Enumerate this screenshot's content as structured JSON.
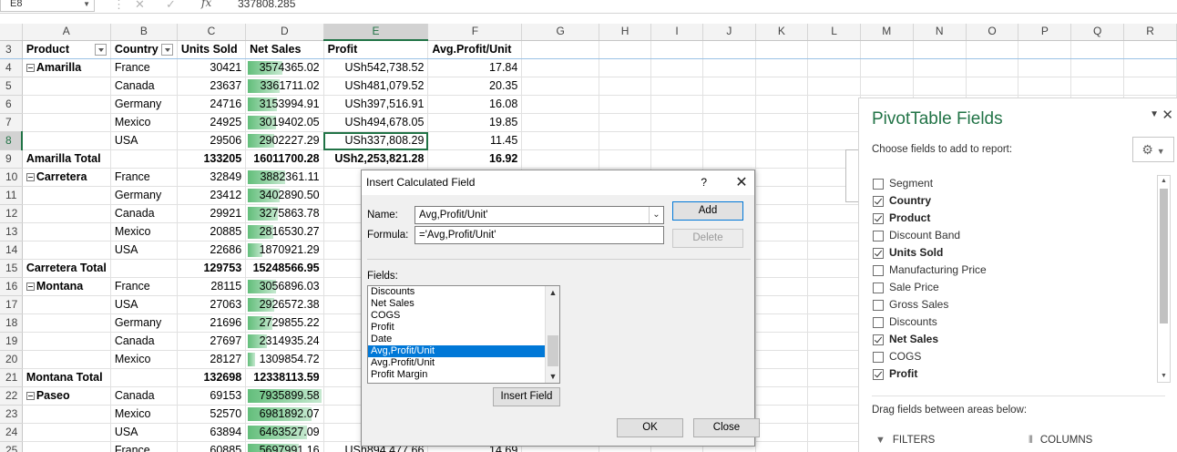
{
  "formula_bar": {
    "name_box": "E8",
    "cancel_icon": "cancel-icon",
    "enter_icon": "enter-icon",
    "fx_label": "fx",
    "content": "337808.285"
  },
  "columns": [
    "A",
    "B",
    "C",
    "D",
    "E",
    "F",
    "G",
    "H",
    "I",
    "J",
    "K",
    "L",
    "M",
    "N",
    "O",
    "P",
    "Q",
    "R"
  ],
  "selected_column": "E",
  "pivot_header": [
    "Product",
    "Country",
    "Units Sold",
    "Net Sales",
    "Profit",
    "Avg.Profit/Unit"
  ],
  "rows": [
    {
      "n": "3",
      "type": "header"
    },
    {
      "n": "4",
      "product": "Amarilla",
      "country": "France",
      "units": "30421",
      "net": "3574365.02",
      "profit": "USh542,738.52",
      "avg": "17.84",
      "collapse": true,
      "bar": 0.49
    },
    {
      "n": "5",
      "product": "",
      "country": "Canada",
      "units": "23637",
      "net": "3361711.02",
      "profit": "USh481,079.52",
      "avg": "20.35",
      "bar": 0.46
    },
    {
      "n": "6",
      "product": "",
      "country": "Germany",
      "units": "24716",
      "net": "3153994.91",
      "profit": "USh397,516.91",
      "avg": "16.08",
      "bar": 0.43
    },
    {
      "n": "7",
      "product": "",
      "country": "Mexico",
      "units": "24925",
      "net": "3019402.05",
      "profit": "USh494,678.05",
      "avg": "19.85",
      "bar": 0.41
    },
    {
      "n": "8",
      "product": "",
      "country": "USA",
      "units": "29506",
      "net": "2902227.29",
      "profit": "USh337,808.29",
      "avg": "11.45",
      "bar": 0.39,
      "active": true
    },
    {
      "n": "9",
      "type": "total",
      "product": "Amarilla Total",
      "units": "133205",
      "net": "16011700.28",
      "profit": "USh2,253,821.28",
      "avg": "16.92"
    },
    {
      "n": "10",
      "product": "Carretera",
      "country": "France",
      "units": "32849",
      "net": "3882361.11",
      "profit": "USh",
      "avg": "",
      "collapse": true,
      "bar": 0.53
    },
    {
      "n": "11",
      "product": "",
      "country": "Germany",
      "units": "23412",
      "net": "3402890.50",
      "profit": "USh",
      "avg": "",
      "bar": 0.46
    },
    {
      "n": "12",
      "product": "",
      "country": "Canada",
      "units": "29921",
      "net": "3275863.78",
      "profit": "USh",
      "avg": "",
      "bar": 0.44
    },
    {
      "n": "13",
      "product": "",
      "country": "Mexico",
      "units": "20885",
      "net": "2816530.27",
      "profit": "USh",
      "avg": "",
      "bar": 0.38
    },
    {
      "n": "14",
      "product": "",
      "country": "USA",
      "units": "22686",
      "net": "1870921.29",
      "profit": "USh",
      "avg": "",
      "bar": 0.23
    },
    {
      "n": "15",
      "type": "total",
      "product": "Carretera Total",
      "units": "129753",
      "net": "15248566.95",
      "profit": "USh2,",
      "avg": ""
    },
    {
      "n": "16",
      "product": "Montana",
      "country": "France",
      "units": "28115",
      "net": "3056896.03",
      "profit": "USh",
      "avg": "",
      "collapse": true,
      "bar": 0.41
    },
    {
      "n": "17",
      "product": "",
      "country": "USA",
      "units": "27063",
      "net": "2926572.38",
      "profit": "USh",
      "avg": "",
      "bar": 0.39
    },
    {
      "n": "18",
      "product": "",
      "country": "Germany",
      "units": "21696",
      "net": "2729855.22",
      "profit": "USh",
      "avg": "",
      "bar": 0.36
    },
    {
      "n": "19",
      "product": "",
      "country": "Canada",
      "units": "27697",
      "net": "2314935.24",
      "profit": "USh",
      "avg": "",
      "bar": 0.3
    },
    {
      "n": "20",
      "product": "",
      "country": "Mexico",
      "units": "28127",
      "net": "1309854.72",
      "profit": "USh",
      "avg": "",
      "bar": 0.14
    },
    {
      "n": "21",
      "type": "total",
      "product": "Montana Total",
      "units": "132698",
      "net": "12338113.59",
      "profit": "USh1,",
      "avg": ""
    },
    {
      "n": "22",
      "product": "Paseo",
      "country": "Canada",
      "units": "69153",
      "net": "7935899.58",
      "profit": "USh1,",
      "avg": "",
      "collapse": true,
      "bar": 1.0
    },
    {
      "n": "23",
      "product": "",
      "country": "Mexico",
      "units": "52570",
      "net": "6981892.07",
      "profit": "USh",
      "avg": "",
      "bar": 0.88
    },
    {
      "n": "24",
      "product": "",
      "country": "USA",
      "units": "63894",
      "net": "6463527.09",
      "profit": "USh",
      "avg": "",
      "bar": 0.81
    },
    {
      "n": "25",
      "product": "",
      "country": "France",
      "units": "60885",
      "net": "5697991.16",
      "profit": "USh894,477.66",
      "avg": "14.69",
      "bar": 0.71
    }
  ],
  "dialog": {
    "title": "Insert Calculated Field",
    "help": "?",
    "close": "✕",
    "name_label": "Name:",
    "name_value": "Avg,Profit/Unit'",
    "formula_label": "Formula:",
    "formula_value": "='Avg,Profit/Unit'",
    "add_label": "Add",
    "delete_label": "Delete",
    "fields_label": "Fields:",
    "fields": [
      "Discounts",
      "Net Sales",
      "COGS",
      "Profit",
      "Date",
      "Avg,Profit/Unit",
      "Avg.Profit/Unit",
      "Profit Margin"
    ],
    "selected_field": 5,
    "insert_field_label": "Insert Field",
    "ok_label": "OK",
    "close_label": "Close"
  },
  "pane": {
    "title": "PivotTable Fields",
    "choose": "Choose fields to add to report:",
    "fields": [
      {
        "label": "Segment",
        "checked": false
      },
      {
        "label": "Country",
        "checked": true
      },
      {
        "label": "Product",
        "checked": true
      },
      {
        "label": "Discount Band",
        "checked": false
      },
      {
        "label": "Units Sold",
        "checked": true
      },
      {
        "label": "Manufacturing Price",
        "checked": false
      },
      {
        "label": "Sale Price",
        "checked": false
      },
      {
        "label": "Gross Sales",
        "checked": false
      },
      {
        "label": "Discounts",
        "checked": false
      },
      {
        "label": "Net Sales",
        "checked": true
      },
      {
        "label": "COGS",
        "checked": false
      },
      {
        "label": "Profit",
        "checked": true
      }
    ],
    "drag_text": "Drag fields between areas below:",
    "filters_label": "FILTERS",
    "columns_label": "COLUMNS"
  },
  "colors": {
    "excel_green": "#217346",
    "databar": "#63be7b",
    "selection_blue": "#0078d7"
  }
}
